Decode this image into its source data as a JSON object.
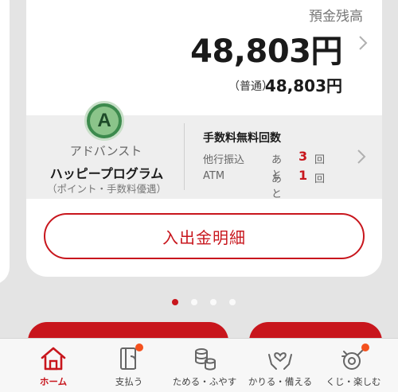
{
  "balance": {
    "label": "預金残高",
    "amount": "48,803円",
    "account_type": "（普通）",
    "account_amount": "48,803円"
  },
  "program": {
    "badge_letter": "A",
    "rank": "アドバンスト",
    "name": "ハッピープログラム",
    "sub": "（ポイント・手数料優遇）"
  },
  "fees": {
    "title": "手数料無料回数",
    "rows": [
      {
        "label": "他行振込",
        "ato": "あと",
        "count": "3",
        "unit": "回"
      },
      {
        "label": "ATM",
        "ato": "あと",
        "count": "1",
        "unit": "回"
      }
    ]
  },
  "detail_button": "入出金明細",
  "pager": {
    "count": 4,
    "active": 0
  },
  "tabs": [
    {
      "label": "ホーム",
      "icon": "home-icon",
      "active": true,
      "badge": false
    },
    {
      "label": "支払う",
      "icon": "card-payment-icon",
      "active": false,
      "badge": true
    },
    {
      "label": "ためる・ふやす",
      "icon": "coins-icon",
      "active": false,
      "badge": false
    },
    {
      "label": "かりる・備える",
      "icon": "hands-heart-icon",
      "active": false,
      "badge": false
    },
    {
      "label": "くじ・楽しむ",
      "icon": "fortune-icon",
      "active": false,
      "badge": true
    }
  ],
  "colors": {
    "accent": "#c8161d",
    "badge_green": "#3c8a4d",
    "notification": "#f4511e"
  }
}
